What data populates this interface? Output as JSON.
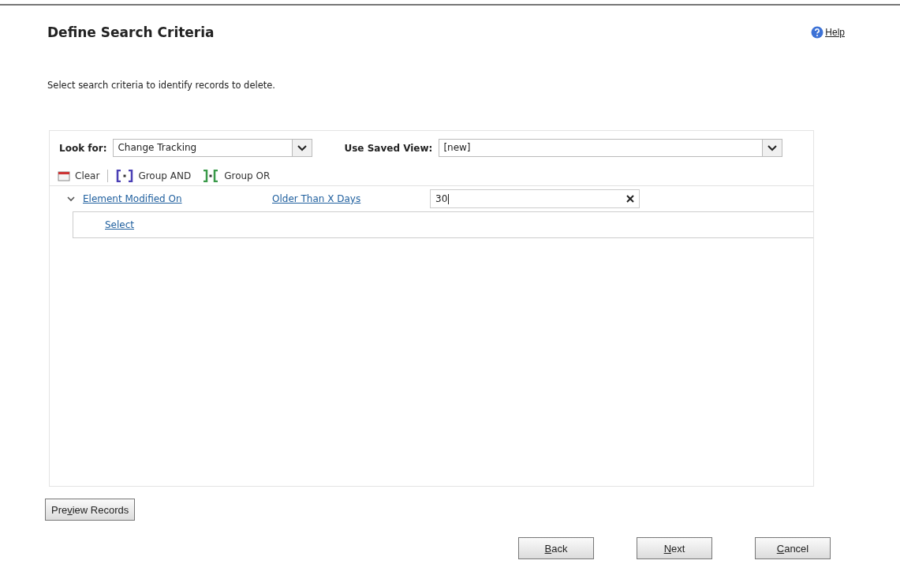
{
  "title": "Define Search Criteria",
  "help": {
    "key": "H",
    "after": "elp"
  },
  "description": "Select search criteria to identify records to delete.",
  "look_for": {
    "label": "Look for:",
    "value": "Change Tracking"
  },
  "saved_view": {
    "label": "Use Saved View:",
    "value": "[new]"
  },
  "toolbar": [
    {
      "kind": "clear",
      "label": "Clear"
    },
    {
      "kind": "and",
      "label": "Group AND"
    },
    {
      "kind": "or",
      "label": "Group OR"
    }
  ],
  "condition": {
    "expanded": true,
    "field": "Element Modified On",
    "operator": "Older Than X Days",
    "value": "30"
  },
  "select_link": "Select",
  "preview_button": {
    "before": "Pre",
    "key": "v",
    "after": "iew Records"
  },
  "buttons": [
    {
      "key": "B",
      "after": "ack"
    },
    {
      "key": "N",
      "after": "ext"
    },
    {
      "key": "C",
      "after": "ancel"
    }
  ]
}
